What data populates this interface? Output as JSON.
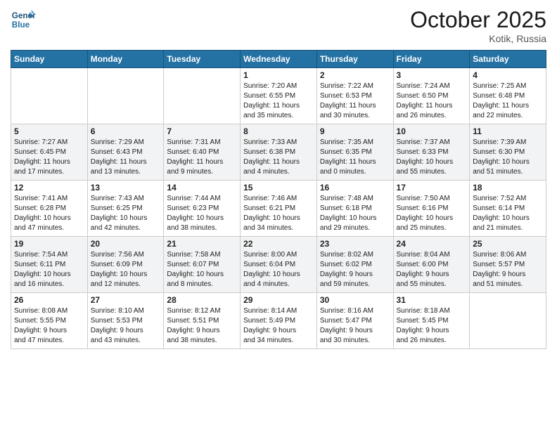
{
  "header": {
    "logo_line1": "General",
    "logo_line2": "Blue",
    "month": "October 2025",
    "location": "Kotik, Russia"
  },
  "days_of_week": [
    "Sunday",
    "Monday",
    "Tuesday",
    "Wednesday",
    "Thursday",
    "Friday",
    "Saturday"
  ],
  "weeks": [
    [
      {
        "day": "",
        "info": ""
      },
      {
        "day": "",
        "info": ""
      },
      {
        "day": "",
        "info": ""
      },
      {
        "day": "1",
        "info": "Sunrise: 7:20 AM\nSunset: 6:55 PM\nDaylight: 11 hours\nand 35 minutes."
      },
      {
        "day": "2",
        "info": "Sunrise: 7:22 AM\nSunset: 6:53 PM\nDaylight: 11 hours\nand 30 minutes."
      },
      {
        "day": "3",
        "info": "Sunrise: 7:24 AM\nSunset: 6:50 PM\nDaylight: 11 hours\nand 26 minutes."
      },
      {
        "day": "4",
        "info": "Sunrise: 7:25 AM\nSunset: 6:48 PM\nDaylight: 11 hours\nand 22 minutes."
      }
    ],
    [
      {
        "day": "5",
        "info": "Sunrise: 7:27 AM\nSunset: 6:45 PM\nDaylight: 11 hours\nand 17 minutes."
      },
      {
        "day": "6",
        "info": "Sunrise: 7:29 AM\nSunset: 6:43 PM\nDaylight: 11 hours\nand 13 minutes."
      },
      {
        "day": "7",
        "info": "Sunrise: 7:31 AM\nSunset: 6:40 PM\nDaylight: 11 hours\nand 9 minutes."
      },
      {
        "day": "8",
        "info": "Sunrise: 7:33 AM\nSunset: 6:38 PM\nDaylight: 11 hours\nand 4 minutes."
      },
      {
        "day": "9",
        "info": "Sunrise: 7:35 AM\nSunset: 6:35 PM\nDaylight: 11 hours\nand 0 minutes."
      },
      {
        "day": "10",
        "info": "Sunrise: 7:37 AM\nSunset: 6:33 PM\nDaylight: 10 hours\nand 55 minutes."
      },
      {
        "day": "11",
        "info": "Sunrise: 7:39 AM\nSunset: 6:30 PM\nDaylight: 10 hours\nand 51 minutes."
      }
    ],
    [
      {
        "day": "12",
        "info": "Sunrise: 7:41 AM\nSunset: 6:28 PM\nDaylight: 10 hours\nand 47 minutes."
      },
      {
        "day": "13",
        "info": "Sunrise: 7:43 AM\nSunset: 6:25 PM\nDaylight: 10 hours\nand 42 minutes."
      },
      {
        "day": "14",
        "info": "Sunrise: 7:44 AM\nSunset: 6:23 PM\nDaylight: 10 hours\nand 38 minutes."
      },
      {
        "day": "15",
        "info": "Sunrise: 7:46 AM\nSunset: 6:21 PM\nDaylight: 10 hours\nand 34 minutes."
      },
      {
        "day": "16",
        "info": "Sunrise: 7:48 AM\nSunset: 6:18 PM\nDaylight: 10 hours\nand 29 minutes."
      },
      {
        "day": "17",
        "info": "Sunrise: 7:50 AM\nSunset: 6:16 PM\nDaylight: 10 hours\nand 25 minutes."
      },
      {
        "day": "18",
        "info": "Sunrise: 7:52 AM\nSunset: 6:14 PM\nDaylight: 10 hours\nand 21 minutes."
      }
    ],
    [
      {
        "day": "19",
        "info": "Sunrise: 7:54 AM\nSunset: 6:11 PM\nDaylight: 10 hours\nand 16 minutes."
      },
      {
        "day": "20",
        "info": "Sunrise: 7:56 AM\nSunset: 6:09 PM\nDaylight: 10 hours\nand 12 minutes."
      },
      {
        "day": "21",
        "info": "Sunrise: 7:58 AM\nSunset: 6:07 PM\nDaylight: 10 hours\nand 8 minutes."
      },
      {
        "day": "22",
        "info": "Sunrise: 8:00 AM\nSunset: 6:04 PM\nDaylight: 10 hours\nand 4 minutes."
      },
      {
        "day": "23",
        "info": "Sunrise: 8:02 AM\nSunset: 6:02 PM\nDaylight: 9 hours\nand 59 minutes."
      },
      {
        "day": "24",
        "info": "Sunrise: 8:04 AM\nSunset: 6:00 PM\nDaylight: 9 hours\nand 55 minutes."
      },
      {
        "day": "25",
        "info": "Sunrise: 8:06 AM\nSunset: 5:57 PM\nDaylight: 9 hours\nand 51 minutes."
      }
    ],
    [
      {
        "day": "26",
        "info": "Sunrise: 8:08 AM\nSunset: 5:55 PM\nDaylight: 9 hours\nand 47 minutes."
      },
      {
        "day": "27",
        "info": "Sunrise: 8:10 AM\nSunset: 5:53 PM\nDaylight: 9 hours\nand 43 minutes."
      },
      {
        "day": "28",
        "info": "Sunrise: 8:12 AM\nSunset: 5:51 PM\nDaylight: 9 hours\nand 38 minutes."
      },
      {
        "day": "29",
        "info": "Sunrise: 8:14 AM\nSunset: 5:49 PM\nDaylight: 9 hours\nand 34 minutes."
      },
      {
        "day": "30",
        "info": "Sunrise: 8:16 AM\nSunset: 5:47 PM\nDaylight: 9 hours\nand 30 minutes."
      },
      {
        "day": "31",
        "info": "Sunrise: 8:18 AM\nSunset: 5:45 PM\nDaylight: 9 hours\nand 26 minutes."
      },
      {
        "day": "",
        "info": ""
      }
    ]
  ]
}
